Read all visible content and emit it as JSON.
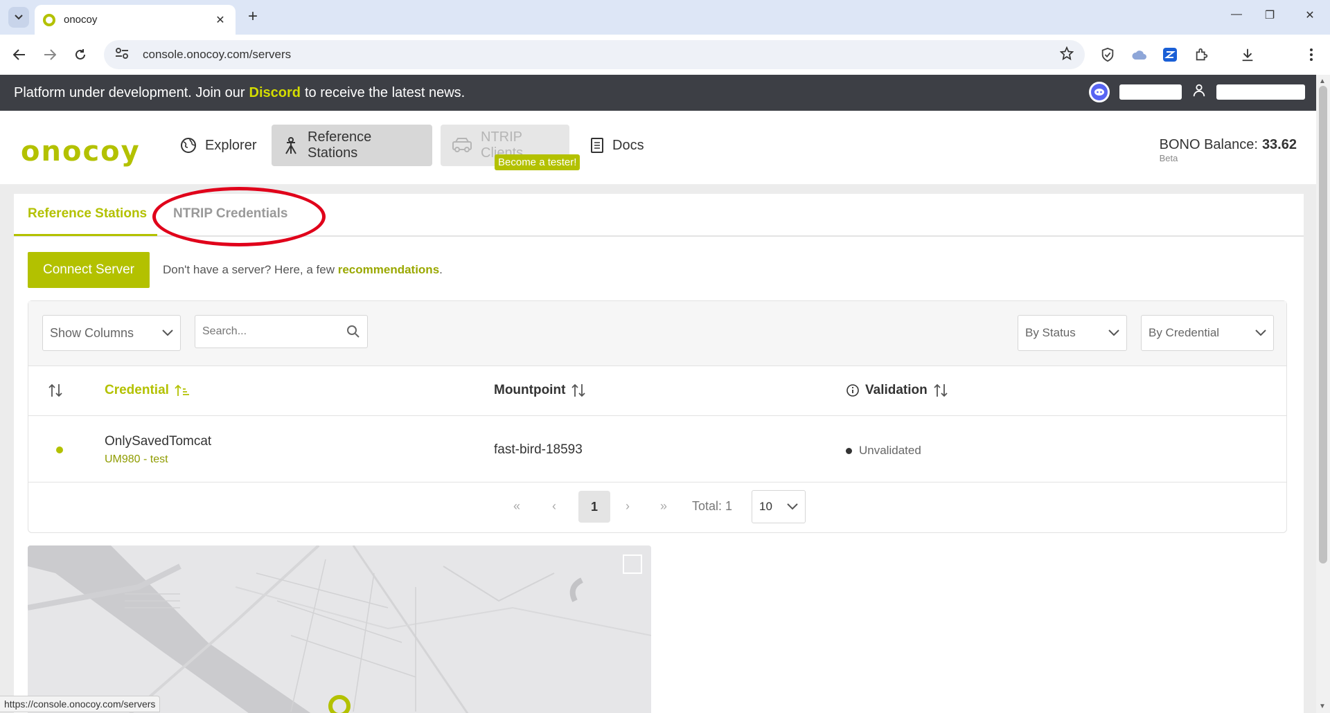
{
  "browser": {
    "tab_title": "onocoy",
    "url": "console.onocoy.com/servers",
    "status_url": "https://console.onocoy.com/servers"
  },
  "banner": {
    "text_before": "Platform under development. Join our",
    "link": "Discord",
    "text_after": "to receive the latest news."
  },
  "header": {
    "logo": "onocoy",
    "nav": [
      {
        "label": "Explorer",
        "icon": "globe-icon"
      },
      {
        "label": "Reference Stations",
        "icon": "tripod-icon"
      },
      {
        "label": "NTRIP Clients",
        "icon": "vehicle-icon"
      },
      {
        "label": "Docs",
        "icon": "document-icon"
      }
    ],
    "tester_badge": "Become a tester!",
    "balance_label": "BONO Balance:",
    "balance_value": "33.62",
    "balance_note": "Beta"
  },
  "page_tabs": [
    {
      "label": "Reference Stations",
      "active": true
    },
    {
      "label": "NTRIP Credentials",
      "active": false
    }
  ],
  "actions": {
    "connect_label": "Connect Server",
    "hint_text": "Don't have a server? Here, a few",
    "hint_link": "recommendations",
    "hint_end": "."
  },
  "filters": {
    "show_columns": "Show Columns",
    "search_placeholder": "Search...",
    "by_status": "By Status",
    "by_credential": "By Credential"
  },
  "table": {
    "columns": [
      "Credential",
      "Mountpoint",
      "Validation"
    ],
    "rows": [
      {
        "credential": "OnlySavedTomcat",
        "sub": "UM980 - test",
        "mountpoint": "fast-bird-18593",
        "validation": "Unvalidated"
      }
    ]
  },
  "pagination": {
    "first": "«",
    "prev": "‹",
    "current": "1",
    "next": "›",
    "last": "»",
    "total": "Total: 1",
    "page_size": "10"
  },
  "colors": {
    "accent": "#b3c100",
    "banner_bg": "#3d3f45",
    "annotation": "#e0001a"
  }
}
